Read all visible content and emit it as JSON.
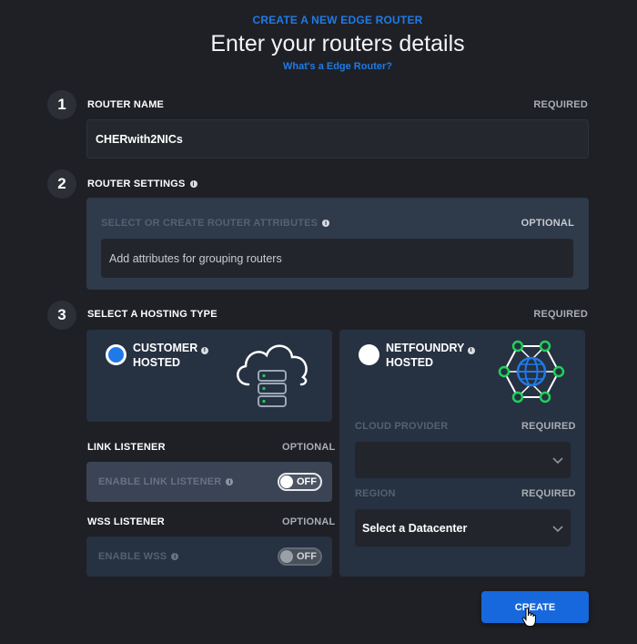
{
  "header": {
    "kicker": "CREATE A NEW EDGE ROUTER",
    "title": "Enter your routers details",
    "help_link": "What's a Edge Router?"
  },
  "steps": [
    "1",
    "2",
    "3"
  ],
  "router_name": {
    "label": "ROUTER NAME",
    "tag": "REQUIRED",
    "value": "CHERwith2NICs"
  },
  "router_settings": {
    "label": "ROUTER SETTINGS",
    "attributes_label": "SELECT OR CREATE ROUTER ATTRIBUTES",
    "attributes_tag": "OPTIONAL",
    "attributes_placeholder": "Add attributes for grouping routers"
  },
  "hosting": {
    "label": "SELECT A HOSTING TYPE",
    "tag": "REQUIRED",
    "customer": {
      "line1": "CUSTOMER",
      "line2": "HOSTED",
      "selected": true,
      "icon": "cloud-server-icon"
    },
    "netfoundry": {
      "line1": "NETFOUNDRY",
      "line2": "HOSTED",
      "selected": false,
      "icon": "globe-network-icon"
    }
  },
  "link_listener": {
    "label": "LINK LISTENER",
    "tag": "OPTIONAL",
    "toggle_label": "ENABLE LINK LISTENER",
    "state": "OFF"
  },
  "wss_listener": {
    "label": "WSS LISTENER",
    "tag": "OPTIONAL",
    "toggle_label": "ENABLE WSS",
    "state": "OFF"
  },
  "cloud": {
    "provider_label": "CLOUD PROVIDER",
    "provider_tag": "REQUIRED",
    "provider_value": "",
    "region_label": "REGION",
    "region_tag": "REQUIRED",
    "region_value": "Select a Datacenter"
  },
  "actions": {
    "create": "CREATE"
  },
  "colors": {
    "accent": "#1f7ae8",
    "node": "#1fd15a",
    "background": "#1e2025"
  }
}
